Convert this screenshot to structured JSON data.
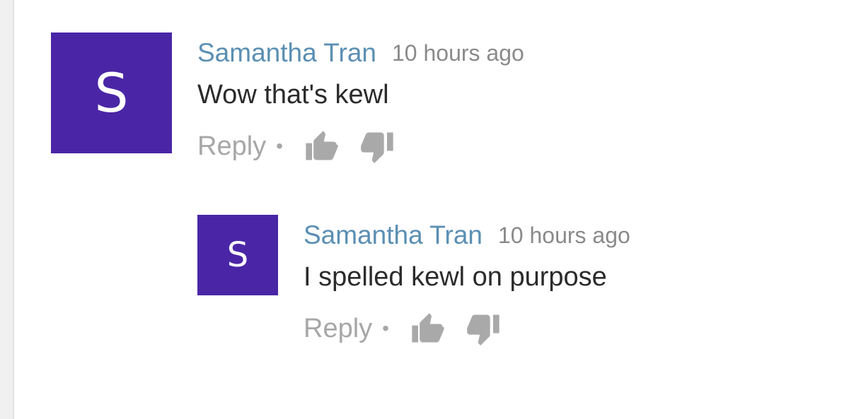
{
  "comments": [
    {
      "avatar_letter": "S",
      "avatar_color": "#4a26a6",
      "author": "Samantha Tran",
      "time": "10 hours ago",
      "text": "Wow that's kewl",
      "reply_label": "Reply",
      "separator": "•",
      "like_icon": "thumbs-up-icon",
      "dislike_icon": "thumbs-down-icon"
    },
    {
      "avatar_letter": "S",
      "avatar_color": "#4a26a6",
      "author": "Samantha Tran",
      "time": "10 hours ago",
      "text": "I spelled kewl on purpose",
      "reply_label": "Reply",
      "separator": "•",
      "like_icon": "thumbs-up-icon",
      "dislike_icon": "thumbs-down-icon"
    }
  ],
  "colors": {
    "author": "#5b8fb3",
    "timestamp": "#8a8a8a",
    "comment_text": "#2b2b2b",
    "actions": "#a7a7a7"
  }
}
